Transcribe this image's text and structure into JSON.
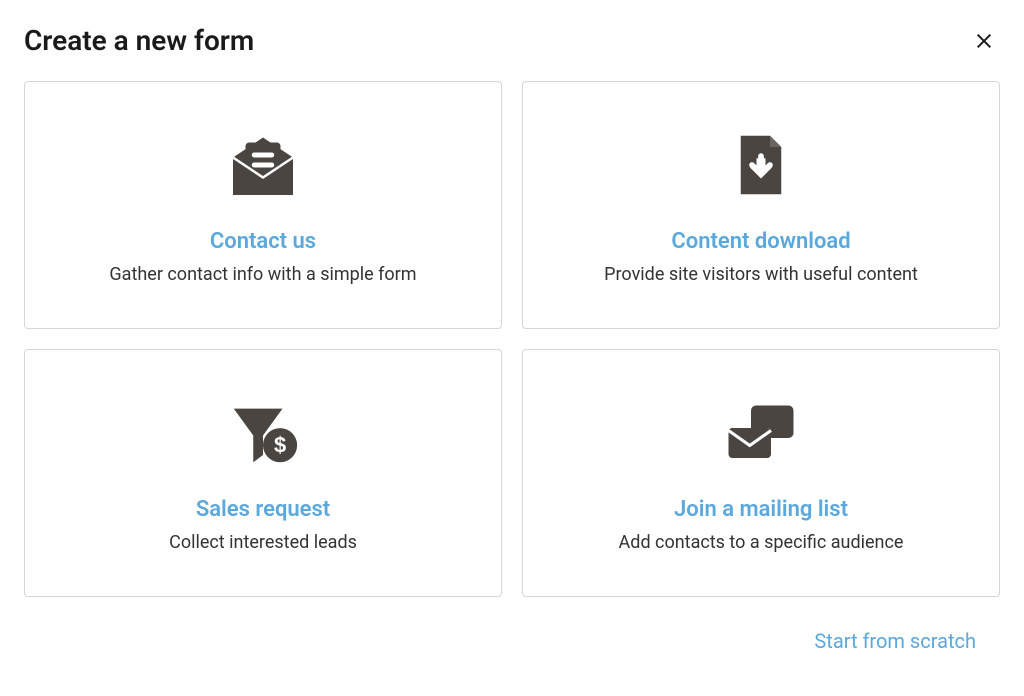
{
  "header": {
    "title": "Create a new form"
  },
  "cards": [
    {
      "title": "Contact us",
      "description": "Gather contact info with a simple form",
      "icon": "envelope-open-icon"
    },
    {
      "title": "Content download",
      "description": "Provide site visitors with useful content",
      "icon": "file-download-icon"
    },
    {
      "title": "Sales request",
      "description": "Collect interested leads",
      "icon": "funnel-dollar-icon"
    },
    {
      "title": "Join a mailing list",
      "description": "Add contacts to a specific audience",
      "icon": "mail-stack-icon"
    }
  ],
  "footer": {
    "scratch_link": "Start from scratch"
  },
  "colors": {
    "link": "#5ba8dc",
    "icon": "#4a4541",
    "border": "#d6d6d6"
  }
}
